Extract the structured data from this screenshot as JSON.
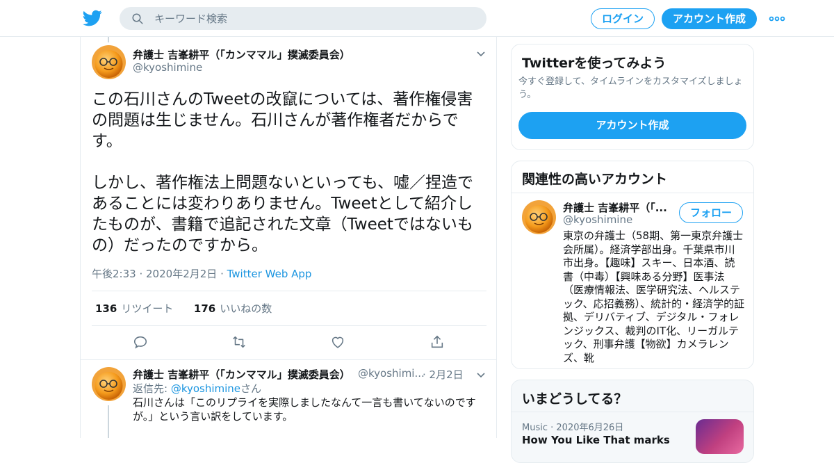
{
  "header": {
    "search_placeholder": "キーワード検索",
    "login_label": "ログイン",
    "signup_label": "アカウント作成"
  },
  "tweet": {
    "author_name": "弁護士 吉峯耕平（「カンママル」撲滅委員会）",
    "author_handle": "@kyoshimine",
    "text": "この石川さんのTweetの改竄については、著作権侵害の問題は生じません。石川さんが著作権者だからです。\n\nしかし、著作権法上問題ないといっても、嘘／捏造であることには変わりありません。Tweetとして紹介したものが、書籍で追記された文章（Tweetではないもの）だったのですから。",
    "time": "午後2:33",
    "date": "2020年2月2日",
    "source": "Twitter Web App",
    "retweet_count": "136",
    "retweet_label": "リツイート",
    "like_count": "176",
    "like_label": "いいねの数"
  },
  "reply": {
    "author_name": "弁護士 吉峯耕平（「カンママル」撲滅委員会）",
    "author_handle": "@kyoshimi...",
    "date": "2月2日",
    "reply_prefix": "返信先: ",
    "reply_to": "@kyoshimine",
    "reply_suffix": "さん",
    "text": "石川さんは「このリプライを実際しましたなんて一言も書いてないのですが。」という言い訳をしています。"
  },
  "sidebar": {
    "try_title": "Twitterを使ってみよう",
    "try_sub": "今すぐ登録して、タイムラインをカスタマイズしましょう。",
    "try_cta": "アカウント作成",
    "related_title": "関連性の高いアカウント",
    "related_name": "弁護士 吉峯耕平（「...",
    "related_handle": "@kyoshimine",
    "follow_label": "フォロー",
    "related_bio": "東京の弁護士（58期、第一東京弁護士会所属）。経済学部出身。千葉県市川市出身。【趣味】スキー、日本酒、読書（中毒）【興味ある分野】医事法（医療情報法、医学研究法、ヘルステック、応招義務）、統計的・経済学的証拠、デリバティブ、デジタル・フォレンジックス、裁判のIT化、リーガルテック、刑事弁護【物欲】カメラレンズ、靴",
    "trends_title": "いまどうしてる？",
    "trend_category": "Music",
    "trend_date": "2020年6月26日",
    "trend_title": "How You Like That marks"
  },
  "colors": {
    "accent": "#1da1f2",
    "link": "#1b95e0",
    "muted": "#657786"
  }
}
